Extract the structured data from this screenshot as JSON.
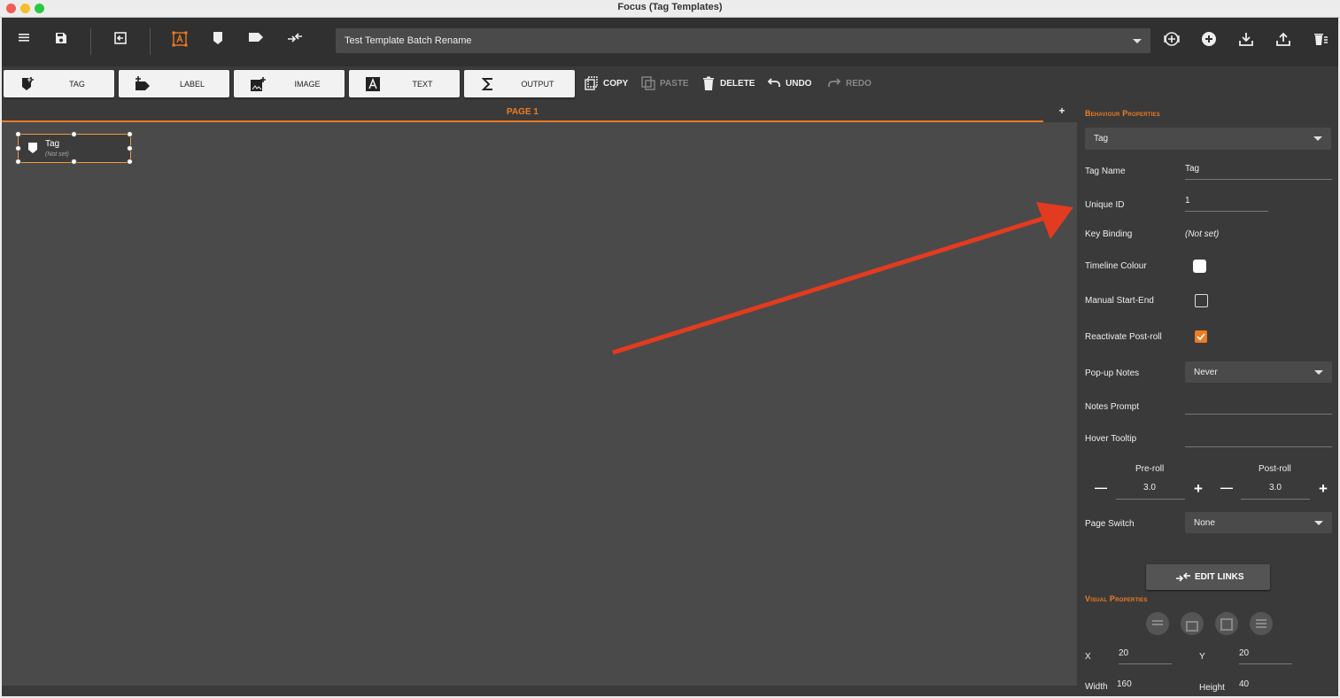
{
  "window": {
    "title": "Focus (Tag Templates)"
  },
  "toolbar": {
    "template_name": "Test Template Batch Rename"
  },
  "modes": [
    {
      "label": "TAG"
    },
    {
      "label": "LABEL"
    },
    {
      "label": "IMAGE"
    },
    {
      "label": "TEXT"
    },
    {
      "label": "OUTPUT"
    }
  ],
  "actions": {
    "copy": "COPY",
    "paste": "PASTE",
    "delete": "DELETE",
    "undo": "UNDO",
    "redo": "REDO"
  },
  "page": {
    "label": "PAGE 1",
    "add": "+"
  },
  "canvas_tag": {
    "name": "Tag",
    "key": "(Not set)"
  },
  "behaviour": {
    "section": "Behaviour Properties",
    "type": "Tag",
    "tag_name_label": "Tag Name",
    "tag_name": "Tag",
    "unique_id_label": "Unique ID",
    "unique_id": "1",
    "key_binding_label": "Key Binding",
    "key_binding": "(Not set)",
    "timeline_colour_label": "Timeline Colour",
    "manual_label": "Manual Start-End",
    "reactivate_label": "Reactivate Post-roll",
    "popup_label": "Pop-up Notes",
    "popup_value": "Never",
    "notes_prompt_label": "Notes Prompt",
    "hover_label": "Hover Tooltip",
    "preroll_label": "Pre-roll",
    "preroll": "3.0",
    "postroll_label": "Post-roll",
    "postroll": "3.0",
    "page_switch_label": "Page Switch",
    "page_switch": "None",
    "edit_links": "EDIT LINKS"
  },
  "visual": {
    "section": "Visual Properties",
    "x_label": "X",
    "x": "20",
    "y_label": "Y",
    "y": "20",
    "width_label": "Width",
    "width": "160",
    "height_label": "Height",
    "height": "40"
  },
  "colors": {
    "accent": "#ef7b22",
    "canvas": "#4a4a4a",
    "panel": "#3a3a3a",
    "arrow": "#e23b1f"
  }
}
